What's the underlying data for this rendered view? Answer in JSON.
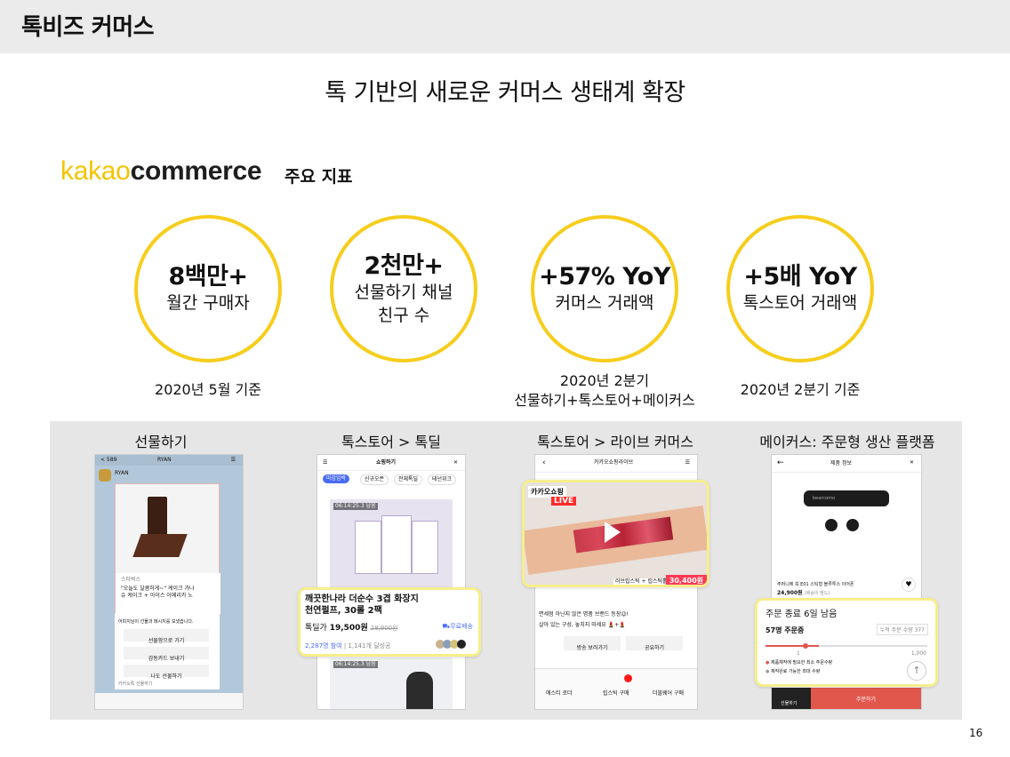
{
  "header": {
    "title": "톡비즈 커머스"
  },
  "subtitle": "톡 기반의 새로운 커머스 생태계 확장",
  "brand": {
    "kakao": "kakao",
    "commerce": "commerce",
    "metrics_label": "주요 지표",
    "color_kakao": "#f3c400"
  },
  "kpis": [
    {
      "value": "8백만+",
      "label": "월간 구매자",
      "note": "2020년 5월 기준"
    },
    {
      "value": "2천만+",
      "label_line1": "선물하기 채널",
      "label_line2": "친구 수"
    },
    {
      "value": "+57% YoY",
      "label": "커머스 거래액",
      "note_line1": "2020년 2분기",
      "note_line2": "선물하기+톡스토어+메이커스"
    },
    {
      "value": "+5배 YoY",
      "label": "톡스토어 거래액",
      "note": "2020년 2분기 기준"
    }
  ],
  "accent_color": "#f7cd1c",
  "showcase": {
    "titles": [
      "선물하기",
      "톡스토어 > 톡딜",
      "톡스토어 > 라이브 커머스",
      "메이커스: 주문형 생산 플랫폼"
    ],
    "gift": {
      "topbar_count": "< 589",
      "topbar_name": "RYAN",
      "sender": "RYAN",
      "brand_tag": "스타벅스",
      "card_line1": "\"오늘도 달콤하게~\" 케이크 가나",
      "card_line2": "슈 케이크 + 아이스 아메리카 노",
      "message": "어피치님이 선물과 메시지를 보냈습니다.",
      "buttons": [
        "선물함으로 가기",
        "감동카드 보내기",
        "나도 선물하기"
      ],
      "footer": "카카오톡 선물하기"
    },
    "talkdeal": {
      "app_title": "쇼핑하기",
      "tabs": [
        "마감임박",
        "신규오픈",
        "전체톡딜",
        "테넌위크"
      ],
      "timer1": "06:14:25.3 남음",
      "timer2": "06:14:25.3 남음",
      "product_title_line1": "깨끗한나라 더순수 3겹 화장지",
      "product_title_line2": "천연펄프, 30롤 2팩",
      "deal_label": "톡딜가",
      "price": "19,500원",
      "original_price": "28,900원",
      "free_shipping": "무료배송",
      "participants": "2,287명 참여",
      "purchases": "1,141개 딜성공"
    },
    "live": {
      "app_title": "카카오쇼핑라이브",
      "live_badge_title": "카카오쇼핑",
      "live_badge": "LIVE",
      "product_name": "러브립스틱 + 립스틱홀더",
      "price": "30,400원",
      "chat_line1": "면세점 아닌지 않은 명품 브랜드 등장😉!",
      "chat_line2": "살아 있는 구성, 놓치지 마세요 💄+💄",
      "buttons": [
        "방송 보러가기",
        "공유하기"
      ],
      "bottom_nav": [
        "애스티 로더",
        "립스틱 구매",
        "더블웨어 구매"
      ]
    },
    "makers": {
      "app_title": "제품 정보",
      "product_brand": "bearcomo",
      "product_name": "주머니에 쏙 E01 스틱형 블루투스 이어폰",
      "price": "24,900원",
      "price_note": "(배송비 별도)",
      "status": "주문 종료 6일 남음",
      "orders": "57명 주문중",
      "accumulated": "누적 주문 수량 377",
      "progress_fraction": 0.33,
      "scale_min": "1",
      "scale_max": "1,000",
      "note1": "제품제작에 필요한 최소 주문수량",
      "note2": "제작완료 가능한 최대 수량",
      "bottom_left": "선물하기",
      "order_button": "주문하기"
    }
  },
  "page_number": "16"
}
